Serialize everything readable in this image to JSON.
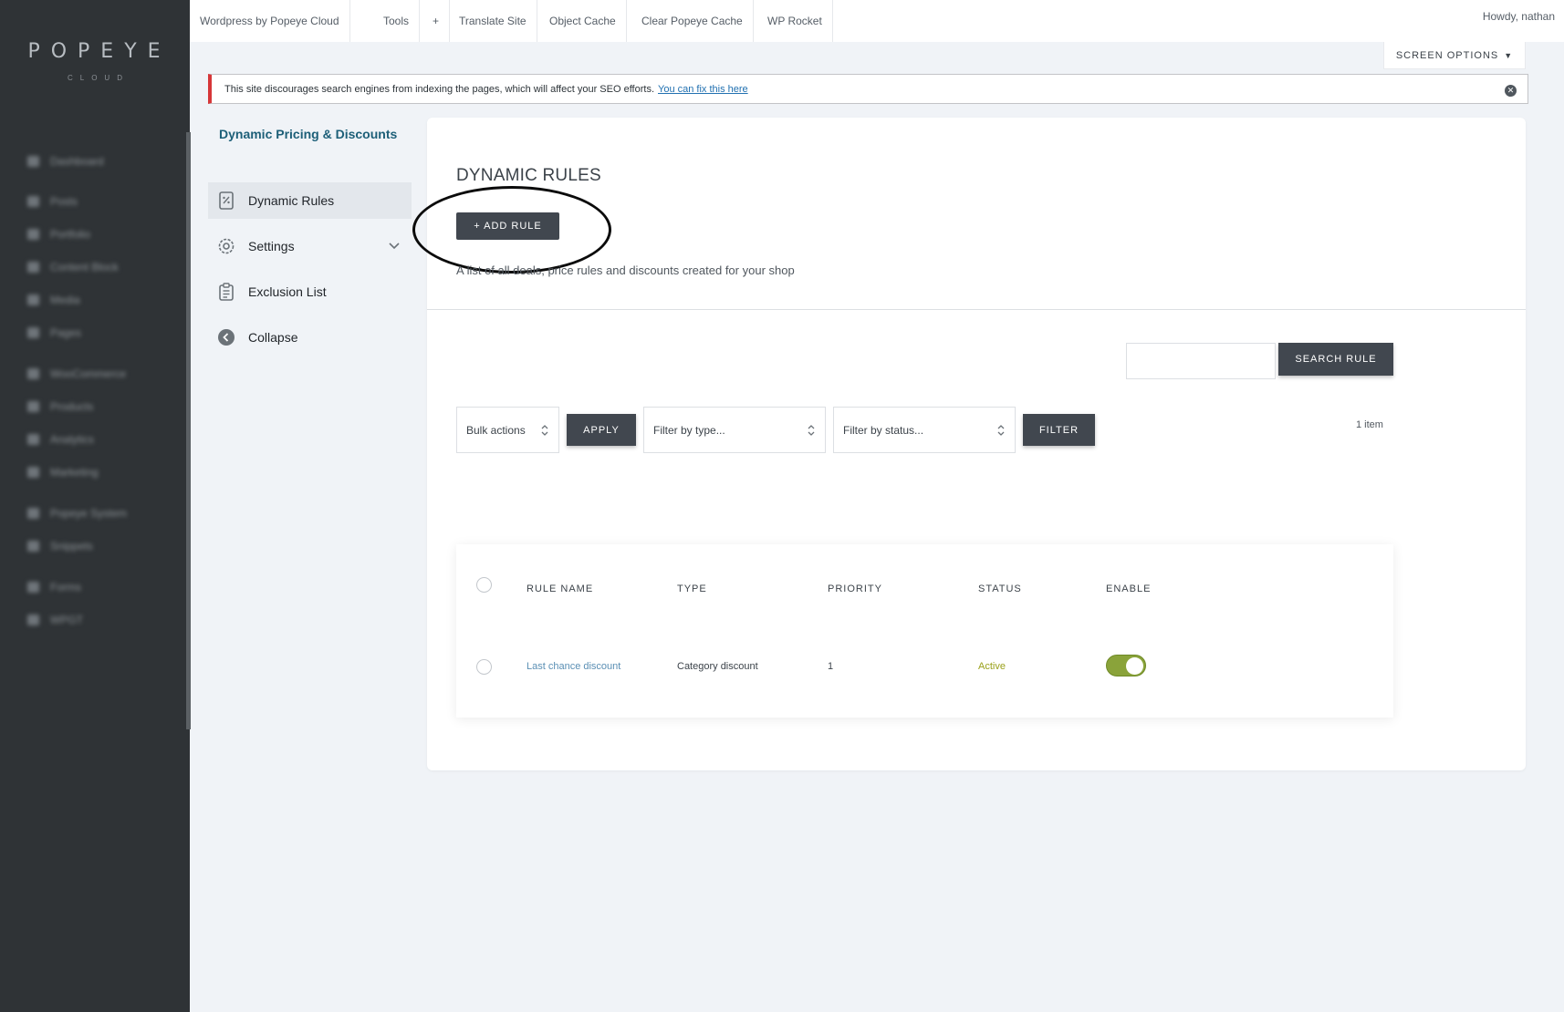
{
  "sidebar": {
    "logo": "POPEYE",
    "logo_sub": "CLOUD",
    "items": [
      {
        "label": "Dashboard",
        "icon": "gauge-icon"
      },
      {
        "label": "Posts",
        "icon": "pin-icon"
      },
      {
        "label": "Portfolio",
        "icon": "portfolio-icon"
      },
      {
        "label": "Content Block",
        "icon": "block-icon"
      },
      {
        "label": "Media",
        "icon": "media-icon"
      },
      {
        "label": "Pages",
        "icon": "page-icon"
      },
      {
        "label": "WooCommerce",
        "icon": "woo-icon"
      },
      {
        "label": "Products",
        "icon": "products-icon"
      },
      {
        "label": "Analytics",
        "icon": "analytics-icon"
      },
      {
        "label": "Marketing",
        "icon": "megaphone-icon"
      },
      {
        "label": "Popeye System",
        "icon": "system-icon"
      },
      {
        "label": "Snippets",
        "icon": "snippets-icon"
      },
      {
        "label": "Forms",
        "icon": "forms-icon"
      },
      {
        "label": "WPGT",
        "icon": "wpgt-icon"
      }
    ]
  },
  "topbar": {
    "items": [
      "Wordpress by Popeye Cloud",
      "Tools",
      "+",
      "Translate Site",
      "Object Cache",
      "Clear Popeye Cache",
      "WP Rocket"
    ],
    "howdy": "Howdy, nathan"
  },
  "screen_options": "SCREEN OPTIONS",
  "notice": {
    "text": "This site discourages search engines from indexing the pages, which will affect your SEO efforts.",
    "link": "You can fix this here"
  },
  "plugin": {
    "title": "Dynamic Pricing & Discounts",
    "nav": [
      {
        "label": "Dynamic Rules",
        "icon": "percent-receipt-icon",
        "active": true
      },
      {
        "label": "Settings",
        "icon": "gear-icon"
      },
      {
        "label": "Exclusion List",
        "icon": "clipboard-icon"
      },
      {
        "label": "Collapse",
        "icon": "arrow-left-circle-icon"
      }
    ]
  },
  "main": {
    "title": "DYNAMIC RULES",
    "add_rule": "+ ADD RULE",
    "description": "A list of all deals, price rules and discounts created for your shop",
    "search_button": "SEARCH RULE",
    "search_value": "",
    "bulk_actions": "Bulk actions",
    "apply": "APPLY",
    "filter_type": "Filter by type...",
    "filter_status": "Filter by status...",
    "filter": "FILTER",
    "item_count": "1 item"
  },
  "table": {
    "headers": [
      "RULE NAME",
      "TYPE",
      "PRIORITY",
      "STATUS",
      "ENABLE"
    ],
    "rows": [
      {
        "name": "Last chance discount",
        "type": "Category discount",
        "priority": "1",
        "status": "Active",
        "enabled": true
      }
    ]
  },
  "colors": {
    "sidebar_bg": "#2f3336",
    "accent_dark": "#41474f",
    "title_teal": "#1d5f78",
    "notice_red": "#d63638",
    "toggle_on": "#8aa33a",
    "status_active": "#9aa11a"
  }
}
